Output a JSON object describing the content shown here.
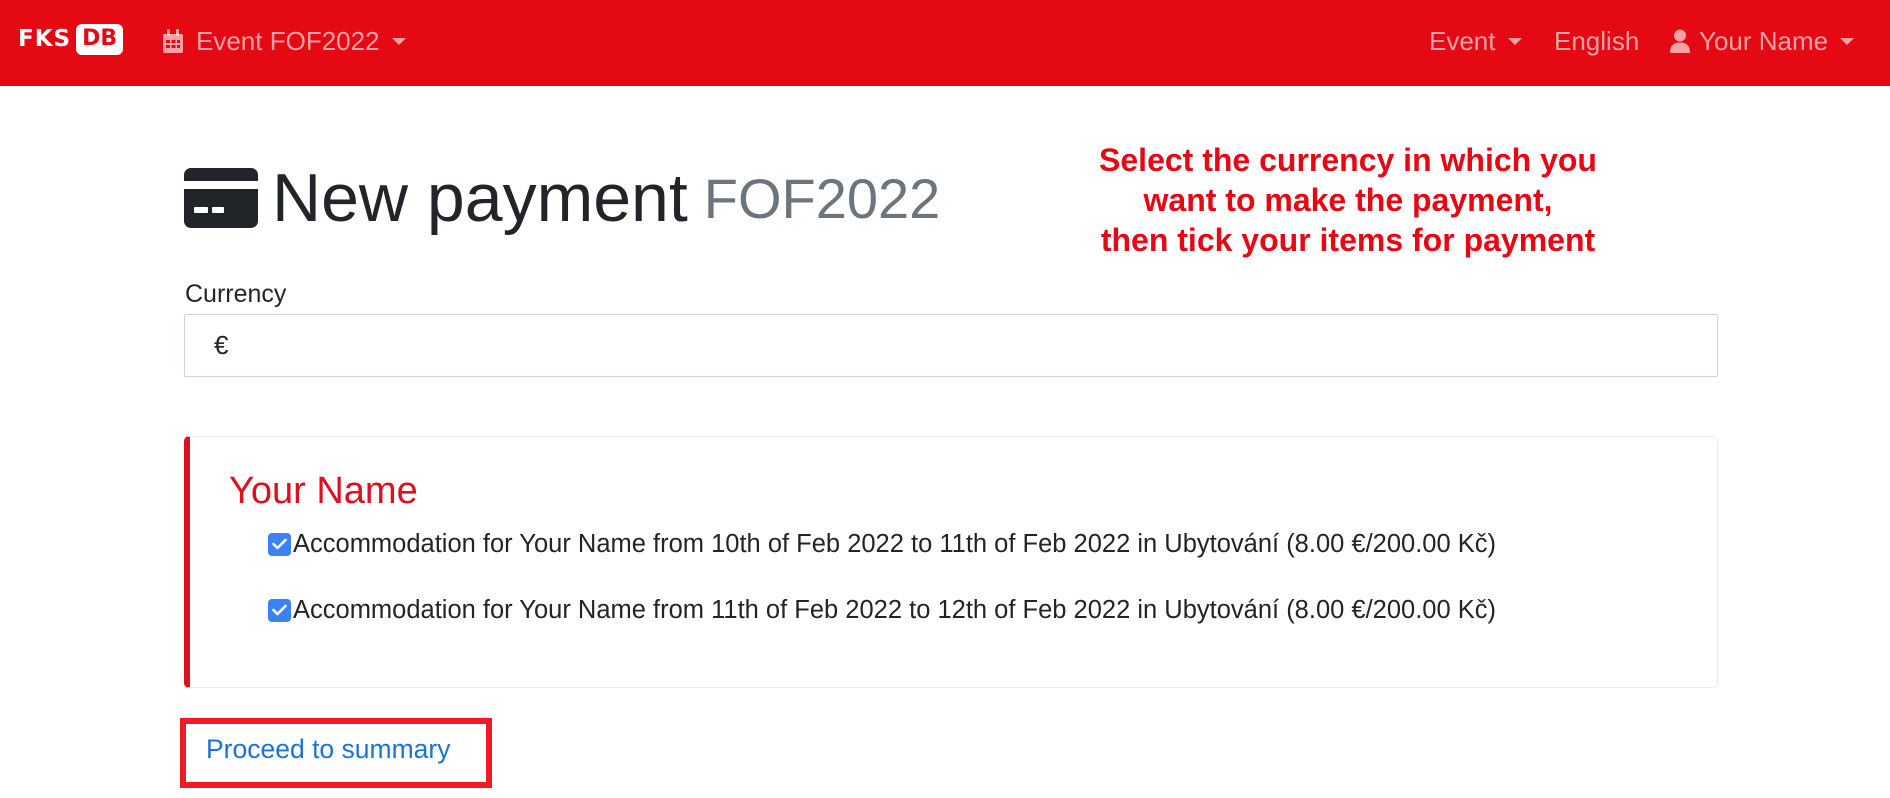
{
  "navbar": {
    "brand": {
      "left": "FKS",
      "right": "DB"
    },
    "event_link": {
      "label": "Event FOF2022",
      "icon": "calendar-icon"
    },
    "event_menu": {
      "label": "Event"
    },
    "language": {
      "label": "English"
    },
    "user_menu": {
      "label": "Your Name",
      "icon": "user-icon"
    },
    "colors": {
      "background": "#e50914"
    }
  },
  "page": {
    "icon": "credit-card-icon",
    "title": "New payment",
    "subtitle": "FOF2022"
  },
  "annotation": {
    "lines": [
      "Select the currency in which you",
      "want to make the payment,",
      "then tick your items for payment"
    ],
    "color": "#e50914"
  },
  "form": {
    "currency_label": "Currency",
    "currency_value": "€"
  },
  "person": {
    "name": "Your Name",
    "items": [
      {
        "label": "Accommodation for Your Name from 10th of Feb 2022 to 11th of Feb 2022 in Ubytování (8.00 €/200.00 Kč)",
        "checked": true
      },
      {
        "label": "Accommodation for Your Name from 11th of Feb 2022 to 12th of Feb 2022 in Ubytování (8.00 €/200.00 Kč)",
        "checked": true
      }
    ]
  },
  "actions": {
    "proceed_label": "Proceed to summary"
  }
}
